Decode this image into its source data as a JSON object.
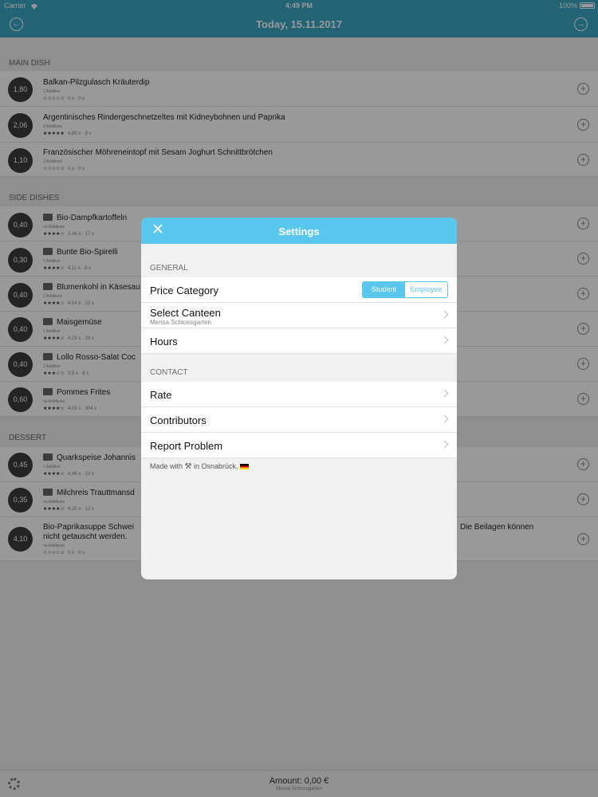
{
  "status_bar": {
    "carrier": "Carrier",
    "time": "4:49 PM",
    "battery": "100%"
  },
  "nav": {
    "title": "Today, 15.11.2017"
  },
  "sections": {
    "main": {
      "header": "MAIN DISH",
      "items": [
        {
          "price": "1,80",
          "name": "Balkan-Pilzgulasch Kräuterdip",
          "sub": "1 Additive",
          "rating": "☆☆☆☆☆",
          "count": "0 x · 0 x"
        },
        {
          "price": "2,06",
          "name": "Argentinisches Rindergeschnetzeltes mit Kidneybohnen und Paprika",
          "sub": "2 Additives",
          "rating": "★★★★★",
          "count": "4,89 x · 9 x"
        },
        {
          "price": "1,10",
          "name": "Französischer Möhreneintopf mit Sesam Joghurt Schnittbrötchen",
          "sub": "3 Additives",
          "rating": "☆☆☆☆☆",
          "count": "0 x · 0 x"
        }
      ]
    },
    "side": {
      "header": "SIDE DISHES",
      "items": [
        {
          "price": "0,40",
          "name": "Bio-Dampfkartoffeln",
          "sub": "no Additives",
          "rating": "★★★★☆",
          "count": "3,46 x · 17 x"
        },
        {
          "price": "0,30",
          "name": "Bunte Bio-Spirelli",
          "sub": "1 Additive",
          "rating": "★★★★☆",
          "count": "4,11 x · 8 x"
        },
        {
          "price": "0,40",
          "name": "Blumenkohl in Käsesau",
          "sub": "2 Additives",
          "rating": "★★★★☆",
          "count": "4,04 x · 22 x"
        },
        {
          "price": "0,40",
          "name": "Maisgemüse",
          "sub": "1 Additive",
          "rating": "★★★★☆",
          "count": "4,23 x · 26 x"
        },
        {
          "price": "0,40",
          "name": "Lollo Rosso-Salat Coc",
          "sub": "1 Additive",
          "rating": "★★★☆☆",
          "count": "3,5 x · 8 x"
        },
        {
          "price": "0,60",
          "name": "Pommes Frites",
          "sub": "no Additives",
          "rating": "★★★★☆",
          "count": "4,03 x · 304 x"
        }
      ]
    },
    "dessert": {
      "header": "DESSERT",
      "items": [
        {
          "price": "0,45",
          "name": "Quarkspeise Johannis",
          "sub": "1 Additive",
          "rating": "★★★★☆",
          "count": "4,46 x · 13 x"
        },
        {
          "price": "0,35",
          "name": "Milchreis Trauttmansd",
          "sub": "no Additives",
          "rating": "★★★★☆",
          "count": "4,25 x · 12 x"
        },
        {
          "price": "4,10",
          "name": "Bio-Paprikasuppe Schwei",
          "name_right": "Die Beilagen können",
          "name_line2": "nicht getauscht werden.",
          "sub": "no Additives",
          "rating": "☆☆☆☆☆",
          "count": "0 x · 0 x"
        }
      ]
    }
  },
  "bottom_bar": {
    "amount": "Amount: 0,00 €",
    "canteen": "Mensa Schlossgarten"
  },
  "settings": {
    "title": "Settings",
    "general_header": "GENERAL",
    "price_category_label": "Price Category",
    "segment_student": "Student",
    "segment_employee": "Employee",
    "select_canteen_label": "Select Canteen",
    "select_canteen_value": "Mensa Schlossgarten",
    "hours_label": "Hours",
    "contact_header": "CONTACT",
    "rate_label": "Rate",
    "contributors_label": "Contributors",
    "report_label": "Report Problem",
    "footer_prefix": "Made with",
    "footer_tools": "⚒",
    "footer_suffix": "in Osnabrück,"
  },
  "colors": {
    "nav": "#3aa7c4",
    "modal_header": "#5ac8ee",
    "price_badge": "#3d3d3d"
  }
}
